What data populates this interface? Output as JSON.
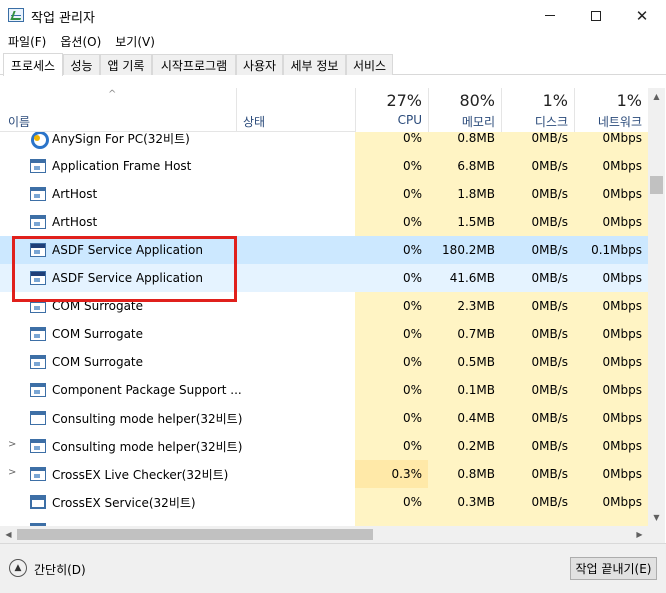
{
  "window": {
    "title": "작업 관리자",
    "minimize_glyph": "—",
    "maximize_glyph": "☐",
    "close_glyph": "✕"
  },
  "menu": [
    "파일(F)",
    "옵션(O)",
    "보기(V)"
  ],
  "tabs": [
    "프로세스",
    "성능",
    "앱 기록",
    "시작프로그램",
    "사용자",
    "세부 정보",
    "서비스"
  ],
  "columns": {
    "name": "이름",
    "status": "상태",
    "cpu": {
      "pct": "27%",
      "label": "CPU"
    },
    "memory": {
      "pct": "80%",
      "label": "메모리"
    },
    "disk": {
      "pct": "1%",
      "label": "디스크"
    },
    "network": {
      "pct": "1%",
      "label": "네트워크"
    }
  },
  "sort_arrow": "^",
  "expand_glyph": ">",
  "processes": [
    {
      "name": "AnySign For PC(32비트)",
      "cpu": "0%",
      "memory": "0.8MB",
      "disk": "0MB/s",
      "network": "0Mbps",
      "icon": "anysign-icon"
    },
    {
      "name": "Application Frame Host",
      "cpu": "0%",
      "memory": "6.8MB",
      "disk": "0MB/s",
      "network": "0Mbps",
      "icon": "process-icon"
    },
    {
      "name": "ArtHost",
      "cpu": "0%",
      "memory": "1.8MB",
      "disk": "0MB/s",
      "network": "0Mbps",
      "icon": "process-icon"
    },
    {
      "name": "ArtHost",
      "cpu": "0%",
      "memory": "1.5MB",
      "disk": "0MB/s",
      "network": "0Mbps",
      "icon": "process-icon"
    },
    {
      "name": "ASDF Service Application",
      "cpu": "0%",
      "memory": "180.2MB",
      "disk": "0MB/s",
      "network": "0.1Mbps",
      "icon": "service-icon"
    },
    {
      "name": "ASDF Service Application",
      "cpu": "0%",
      "memory": "41.6MB",
      "disk": "0MB/s",
      "network": "0Mbps",
      "icon": "service-icon"
    },
    {
      "name": "COM Surrogate",
      "cpu": "0%",
      "memory": "2.3MB",
      "disk": "0MB/s",
      "network": "0Mbps",
      "icon": "process-icon"
    },
    {
      "name": "COM Surrogate",
      "cpu": "0%",
      "memory": "0.7MB",
      "disk": "0MB/s",
      "network": "0Mbps",
      "icon": "process-icon"
    },
    {
      "name": "COM Surrogate",
      "cpu": "0%",
      "memory": "0.5MB",
      "disk": "0MB/s",
      "network": "0Mbps",
      "icon": "process-icon"
    },
    {
      "name": "Component Package Support ...",
      "cpu": "0%",
      "memory": "0.1MB",
      "disk": "0MB/s",
      "network": "0Mbps",
      "icon": "process-icon"
    },
    {
      "name": "Consulting mode helper(32비트)",
      "cpu": "0%",
      "memory": "0.4MB",
      "disk": "0MB/s",
      "network": "0Mbps",
      "icon": "helper-icon"
    },
    {
      "name": "Consulting mode helper(32비트)",
      "cpu": "0%",
      "memory": "0.2MB",
      "disk": "0MB/s",
      "network": "0Mbps",
      "icon": "process-icon",
      "expandable": true
    },
    {
      "name": "CrossEX Live Checker(32비트)",
      "cpu": "0.3%",
      "memory": "0.8MB",
      "disk": "0MB/s",
      "network": "0Mbps",
      "icon": "process-icon",
      "expandable": true
    },
    {
      "name": "CrossEX Service(32비트)",
      "cpu": "0%",
      "memory": "0.3MB",
      "disk": "0MB/s",
      "network": "0Mbps",
      "icon": "window-icon"
    }
  ],
  "footer": {
    "collapse_label": "간단히(D)",
    "end_task_label": "작업 끝내기(E)"
  }
}
